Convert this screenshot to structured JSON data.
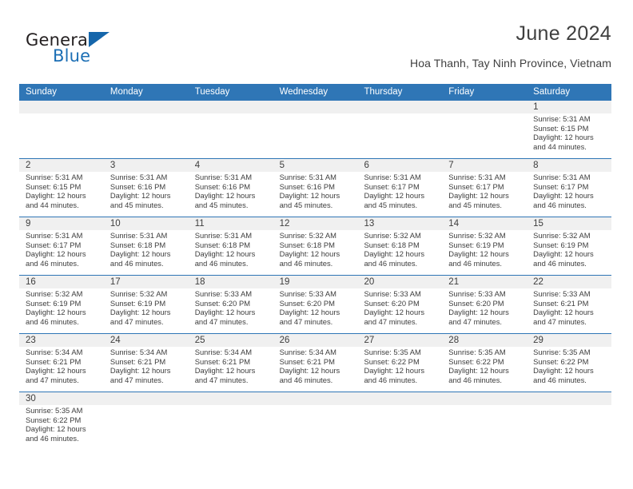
{
  "brand": {
    "name_top": "General",
    "name_bottom": "Blue",
    "triangle_color": "#1566ab",
    "blue_text_color": "#1c6fb5"
  },
  "header": {
    "title": "June 2024",
    "subtitle": "Hoa Thanh, Tay Ninh Province, Vietnam"
  },
  "colors": {
    "header_blue": "#2f76b6",
    "daynum_band": "#f0f0f0",
    "text": "#3d3d3d"
  },
  "calendar": {
    "weekday_headers": [
      "Sunday",
      "Monday",
      "Tuesday",
      "Wednesday",
      "Thursday",
      "Friday",
      "Saturday"
    ],
    "weeks": [
      {
        "days": [
          {
            "empty": true
          },
          {
            "empty": true
          },
          {
            "empty": true
          },
          {
            "empty": true
          },
          {
            "empty": true
          },
          {
            "empty": true
          },
          {
            "date": "1",
            "sunrise": "Sunrise: 5:31 AM",
            "sunset": "Sunset: 6:15 PM",
            "daylight1": "Daylight: 12 hours",
            "daylight2": "and 44 minutes."
          }
        ]
      },
      {
        "days": [
          {
            "date": "2",
            "sunrise": "Sunrise: 5:31 AM",
            "sunset": "Sunset: 6:15 PM",
            "daylight1": "Daylight: 12 hours",
            "daylight2": "and 44 minutes."
          },
          {
            "date": "3",
            "sunrise": "Sunrise: 5:31 AM",
            "sunset": "Sunset: 6:16 PM",
            "daylight1": "Daylight: 12 hours",
            "daylight2": "and 45 minutes."
          },
          {
            "date": "4",
            "sunrise": "Sunrise: 5:31 AM",
            "sunset": "Sunset: 6:16 PM",
            "daylight1": "Daylight: 12 hours",
            "daylight2": "and 45 minutes."
          },
          {
            "date": "5",
            "sunrise": "Sunrise: 5:31 AM",
            "sunset": "Sunset: 6:16 PM",
            "daylight1": "Daylight: 12 hours",
            "daylight2": "and 45 minutes."
          },
          {
            "date": "6",
            "sunrise": "Sunrise: 5:31 AM",
            "sunset": "Sunset: 6:17 PM",
            "daylight1": "Daylight: 12 hours",
            "daylight2": "and 45 minutes."
          },
          {
            "date": "7",
            "sunrise": "Sunrise: 5:31 AM",
            "sunset": "Sunset: 6:17 PM",
            "daylight1": "Daylight: 12 hours",
            "daylight2": "and 45 minutes."
          },
          {
            "date": "8",
            "sunrise": "Sunrise: 5:31 AM",
            "sunset": "Sunset: 6:17 PM",
            "daylight1": "Daylight: 12 hours",
            "daylight2": "and 46 minutes."
          }
        ]
      },
      {
        "days": [
          {
            "date": "9",
            "sunrise": "Sunrise: 5:31 AM",
            "sunset": "Sunset: 6:17 PM",
            "daylight1": "Daylight: 12 hours",
            "daylight2": "and 46 minutes."
          },
          {
            "date": "10",
            "sunrise": "Sunrise: 5:31 AM",
            "sunset": "Sunset: 6:18 PM",
            "daylight1": "Daylight: 12 hours",
            "daylight2": "and 46 minutes."
          },
          {
            "date": "11",
            "sunrise": "Sunrise: 5:31 AM",
            "sunset": "Sunset: 6:18 PM",
            "daylight1": "Daylight: 12 hours",
            "daylight2": "and 46 minutes."
          },
          {
            "date": "12",
            "sunrise": "Sunrise: 5:32 AM",
            "sunset": "Sunset: 6:18 PM",
            "daylight1": "Daylight: 12 hours",
            "daylight2": "and 46 minutes."
          },
          {
            "date": "13",
            "sunrise": "Sunrise: 5:32 AM",
            "sunset": "Sunset: 6:18 PM",
            "daylight1": "Daylight: 12 hours",
            "daylight2": "and 46 minutes."
          },
          {
            "date": "14",
            "sunrise": "Sunrise: 5:32 AM",
            "sunset": "Sunset: 6:19 PM",
            "daylight1": "Daylight: 12 hours",
            "daylight2": "and 46 minutes."
          },
          {
            "date": "15",
            "sunrise": "Sunrise: 5:32 AM",
            "sunset": "Sunset: 6:19 PM",
            "daylight1": "Daylight: 12 hours",
            "daylight2": "and 46 minutes."
          }
        ]
      },
      {
        "days": [
          {
            "date": "16",
            "sunrise": "Sunrise: 5:32 AM",
            "sunset": "Sunset: 6:19 PM",
            "daylight1": "Daylight: 12 hours",
            "daylight2": "and 46 minutes."
          },
          {
            "date": "17",
            "sunrise": "Sunrise: 5:32 AM",
            "sunset": "Sunset: 6:19 PM",
            "daylight1": "Daylight: 12 hours",
            "daylight2": "and 47 minutes."
          },
          {
            "date": "18",
            "sunrise": "Sunrise: 5:33 AM",
            "sunset": "Sunset: 6:20 PM",
            "daylight1": "Daylight: 12 hours",
            "daylight2": "and 47 minutes."
          },
          {
            "date": "19",
            "sunrise": "Sunrise: 5:33 AM",
            "sunset": "Sunset: 6:20 PM",
            "daylight1": "Daylight: 12 hours",
            "daylight2": "and 47 minutes."
          },
          {
            "date": "20",
            "sunrise": "Sunrise: 5:33 AM",
            "sunset": "Sunset: 6:20 PM",
            "daylight1": "Daylight: 12 hours",
            "daylight2": "and 47 minutes."
          },
          {
            "date": "21",
            "sunrise": "Sunrise: 5:33 AM",
            "sunset": "Sunset: 6:20 PM",
            "daylight1": "Daylight: 12 hours",
            "daylight2": "and 47 minutes."
          },
          {
            "date": "22",
            "sunrise": "Sunrise: 5:33 AM",
            "sunset": "Sunset: 6:21 PM",
            "daylight1": "Daylight: 12 hours",
            "daylight2": "and 47 minutes."
          }
        ]
      },
      {
        "days": [
          {
            "date": "23",
            "sunrise": "Sunrise: 5:34 AM",
            "sunset": "Sunset: 6:21 PM",
            "daylight1": "Daylight: 12 hours",
            "daylight2": "and 47 minutes."
          },
          {
            "date": "24",
            "sunrise": "Sunrise: 5:34 AM",
            "sunset": "Sunset: 6:21 PM",
            "daylight1": "Daylight: 12 hours",
            "daylight2": "and 47 minutes."
          },
          {
            "date": "25",
            "sunrise": "Sunrise: 5:34 AM",
            "sunset": "Sunset: 6:21 PM",
            "daylight1": "Daylight: 12 hours",
            "daylight2": "and 47 minutes."
          },
          {
            "date": "26",
            "sunrise": "Sunrise: 5:34 AM",
            "sunset": "Sunset: 6:21 PM",
            "daylight1": "Daylight: 12 hours",
            "daylight2": "and 46 minutes."
          },
          {
            "date": "27",
            "sunrise": "Sunrise: 5:35 AM",
            "sunset": "Sunset: 6:22 PM",
            "daylight1": "Daylight: 12 hours",
            "daylight2": "and 46 minutes."
          },
          {
            "date": "28",
            "sunrise": "Sunrise: 5:35 AM",
            "sunset": "Sunset: 6:22 PM",
            "daylight1": "Daylight: 12 hours",
            "daylight2": "and 46 minutes."
          },
          {
            "date": "29",
            "sunrise": "Sunrise: 5:35 AM",
            "sunset": "Sunset: 6:22 PM",
            "daylight1": "Daylight: 12 hours",
            "daylight2": "and 46 minutes."
          }
        ]
      },
      {
        "days": [
          {
            "date": "30",
            "sunrise": "Sunrise: 5:35 AM",
            "sunset": "Sunset: 6:22 PM",
            "daylight1": "Daylight: 12 hours",
            "daylight2": "and 46 minutes."
          },
          {
            "empty": true
          },
          {
            "empty": true
          },
          {
            "empty": true
          },
          {
            "empty": true
          },
          {
            "empty": true
          },
          {
            "empty": true
          }
        ]
      }
    ]
  }
}
